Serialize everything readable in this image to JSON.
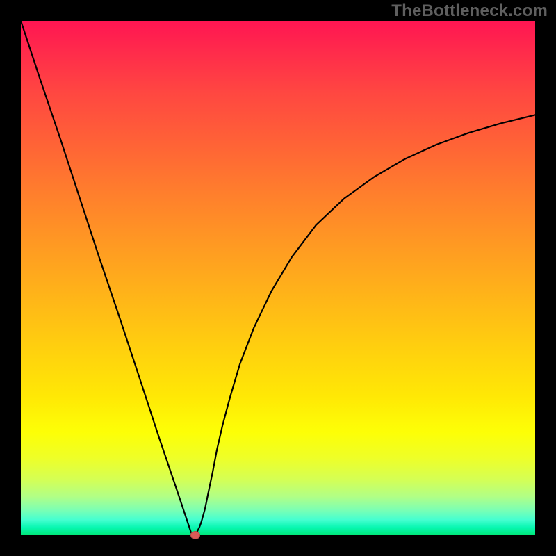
{
  "watermark": "TheBottleneck.com",
  "colors": {
    "background": "#000000",
    "curve": "#000000",
    "marker": "#d85a57"
  },
  "chart_data": {
    "type": "line",
    "title": "",
    "xlabel": "",
    "ylabel": "",
    "xlim": [
      0,
      100
    ],
    "ylim": [
      0,
      100
    ],
    "grid": false,
    "legend": false,
    "annotations": [],
    "background_gradient": {
      "orientation": "vertical",
      "stops": [
        {
          "pos": 0,
          "color": "#ff1552"
        },
        {
          "pos": 50,
          "color": "#ffb319"
        },
        {
          "pos": 80,
          "color": "#fdff06"
        },
        {
          "pos": 100,
          "color": "#00e87a"
        }
      ]
    },
    "series": [
      {
        "name": "curve",
        "x": [
          0.0,
          3.8,
          7.7,
          11.5,
          15.3,
          19.2,
          23.0,
          26.8,
          30.7,
          32.4,
          33.1,
          33.9,
          34.7,
          35.1,
          35.8,
          36.5,
          37.3,
          38.1,
          39.2,
          40.7,
          42.6,
          45.3,
          48.7,
          52.7,
          57.4,
          62.8,
          68.6,
          74.6,
          80.7,
          87.0,
          93.4,
          100.0
        ],
        "y": [
          100.0,
          88.5,
          77.0,
          65.4,
          53.8,
          42.3,
          30.8,
          19.2,
          7.7,
          2.6,
          0.5,
          0.0,
          1.5,
          2.6,
          5.1,
          8.5,
          12.3,
          16.5,
          21.3,
          26.9,
          33.3,
          40.3,
          47.4,
          54.1,
          60.3,
          65.4,
          69.6,
          73.1,
          75.9,
          78.2,
          80.1,
          81.7
        ]
      }
    ],
    "marker": {
      "x": 33.9,
      "y": 0.0
    }
  }
}
